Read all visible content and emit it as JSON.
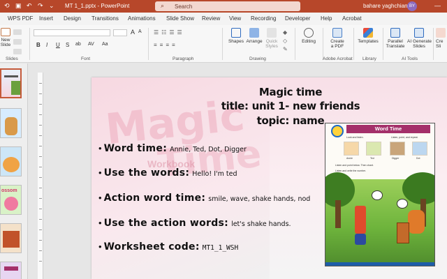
{
  "title_bar": {
    "document_title": "MT 1_1.pptx  -  PowerPoint",
    "search_placeholder": "Search",
    "user_name": "bahare yaghchian",
    "user_initials": "BY"
  },
  "menu_tabs": [
    "WPS PDF",
    "Insert",
    "Design",
    "Transitions",
    "Animations",
    "Slide Show",
    "Review",
    "View",
    "Recording",
    "Developer",
    "Help",
    "Acrobat"
  ],
  "ribbon": {
    "slides_group": {
      "new_slide": "New\nSlide",
      "label": "Slides"
    },
    "font_group": {
      "label": "Font",
      "format_buttons": [
        "B",
        "I",
        "U",
        "S",
        "ab",
        "AV",
        "Aa"
      ]
    },
    "paragraph_group": {
      "label": "Paragraph"
    },
    "drawing_group": {
      "label": "Drawing",
      "shapes": "Shapes",
      "arrange": "Arrange",
      "quick_styles": "Quick\nStyles"
    },
    "editing": "Editing",
    "adobe_group": {
      "label": "Adobe Acrobat",
      "create_pdf": "Create\na PDF"
    },
    "library_group": {
      "label": "Library",
      "templates": "Templates"
    },
    "ai_group": {
      "label": "AI Tools",
      "parallel_translate": "Parallel\nTranslate",
      "ai_generate": "AI Generate\nSlides"
    },
    "cut_off": "Cre\nSli"
  },
  "thumbnails": {
    "count_visible": 6,
    "selected_index": 0,
    "thumb_label_4": "ossom"
  },
  "slide": {
    "heading": [
      "Magic time",
      "title: unit 1- new friends",
      "topic: name"
    ],
    "bullets": [
      {
        "label": "Word time:",
        "value": "Annie, Ted, Dot, Digger",
        "mono": false
      },
      {
        "label": "Use the words:",
        "value": "Hello! I'm ted",
        "mono": false
      },
      {
        "label": "Action word time:",
        "value": "smile, wave, shake hands, nod",
        "mono": false
      },
      {
        "label": "Use the action words:",
        "value": "let's shake hands.",
        "mono": false
      },
      {
        "label": "Worksheet code:",
        "value": "MT1_1_WSH",
        "mono": true
      }
    ],
    "background_words": {
      "magic": "Magic",
      "time": "Time",
      "workbook": "Workbook"
    },
    "worksheet": {
      "title": "Word Time",
      "row_a": "Look and listen.",
      "row_b": "Listen, point, and repeat.",
      "names": [
        "Annie",
        "Ted",
        "Digger",
        "Dot"
      ],
      "row_c": "Listen and point below. Then chant.",
      "row_d": "Listen and write the number."
    }
  },
  "colors": {
    "title_bar": "#b7472a",
    "selected_thumb_border": "#c55a3a",
    "worksheet_title": "#a4306a"
  }
}
